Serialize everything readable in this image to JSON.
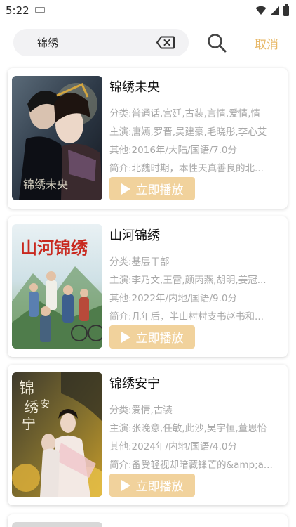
{
  "status_bar": {
    "time": "5:22"
  },
  "search": {
    "query": "锦绣",
    "cancel_label": "取消"
  },
  "results": [
    {
      "title": "锦绣未央",
      "category": "分类:普通话,宫廷,古装,言情,爱情,情",
      "cast": "主演:唐嫣,罗晋,吴建豪,毛晓彤,李心艾",
      "other": "其他:2016年/大陆/国语/7.0分",
      "intro": "简介:北魏时期，本性天真善良的北...",
      "play_label": "立即播放",
      "poster_text": "锦绣未央"
    },
    {
      "title": "山河锦绣",
      "category": "分类:基层干部",
      "cast": "主演:李乃文,王雷,颜丙燕,胡明,姜冠...",
      "other": "其他:2022年/内地/国语/9.0分",
      "intro": "简介:几年后，半山村村支书赵书和...",
      "play_label": "立即播放",
      "poster_text": "山河锦绣"
    },
    {
      "title": "锦绣安宁",
      "category": "分类:爱情,古装",
      "cast": "主演:张晚意,任敏,此沙,吴宇恒,董思怡",
      "other": "其他:2024年/内地/国语/4.0分",
      "intro": "简介:备受轻视却暗藏锋芒的&amp;a...",
      "play_label": "立即播放",
      "poster_text": "锦绣安宁"
    }
  ],
  "colors": {
    "accent": "#e8b96a",
    "play_button": "#f1d29c",
    "meta_text": "#a8a8a8"
  }
}
